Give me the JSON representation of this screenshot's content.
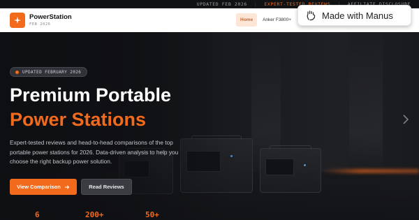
{
  "topbar": {
    "updated": "UPDATED FEB 2026",
    "tested": "EXPERT-TESTED REVIEWS",
    "affiliate": "AFFILIATE DISCLOSURE",
    "separator": "|"
  },
  "header": {
    "brand": "PowerStation",
    "brand_sub": "FEB 2026",
    "nav": [
      {
        "label": "Home"
      },
      {
        "label": "Anker F3800+"
      }
    ]
  },
  "manus_badge": {
    "label": "Made with Manus"
  },
  "hero": {
    "badge": "UPDATED FEBRUARY 2026",
    "title_line1": "Premium Portable",
    "title_line2": "Power Stations",
    "description": "Expert-tested reviews and head-to-head comparisons of the top portable power stations for 2026. Data-driven analysis to help you choose the right backup power solution.",
    "primary_button": "View Comparison",
    "secondary_button": "Read Reviews",
    "stats": [
      {
        "value": "6"
      },
      {
        "value": "200+"
      },
      {
        "value": "50+"
      }
    ]
  },
  "colors": {
    "accent": "#f26b1d",
    "background": "#0e0f12",
    "header_bg": "#ffffff",
    "nav_active_bg": "#fde6d6"
  },
  "icons": [
    "bolt-icon",
    "arrow-right-icon",
    "manus-hand-icon",
    "chevron-right-icon"
  ]
}
